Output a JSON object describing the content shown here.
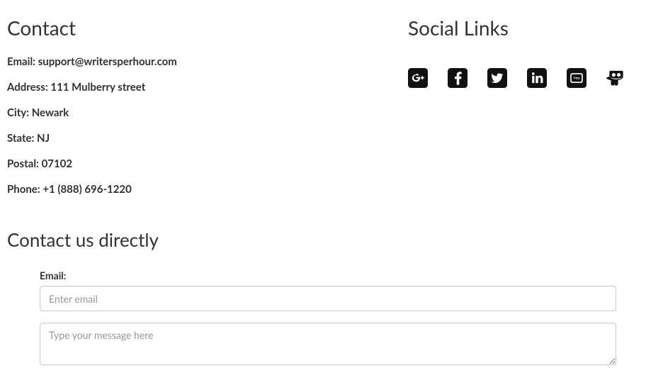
{
  "contact": {
    "heading": "Contact",
    "lines": {
      "email": "Email: support@writersperhour.com",
      "address": "Address: 111 Mulberry street",
      "city": "City: Newark",
      "state": "State: NJ",
      "postal": "Postal: 07102",
      "phone": "Phone: +1 (888) 696-1220"
    }
  },
  "direct": {
    "heading": "Contact us directly",
    "email_label": "Email:",
    "email_placeholder": "Enter email",
    "message_placeholder": "Type your message here"
  },
  "social": {
    "heading": "Social Links",
    "icons": {
      "googleplus": "google-plus-icon",
      "facebook": "facebook-icon",
      "twitter": "twitter-icon",
      "linkedin": "linkedin-icon",
      "youtube": "youtube-icon",
      "slideshare": "slideshare-icon"
    }
  }
}
